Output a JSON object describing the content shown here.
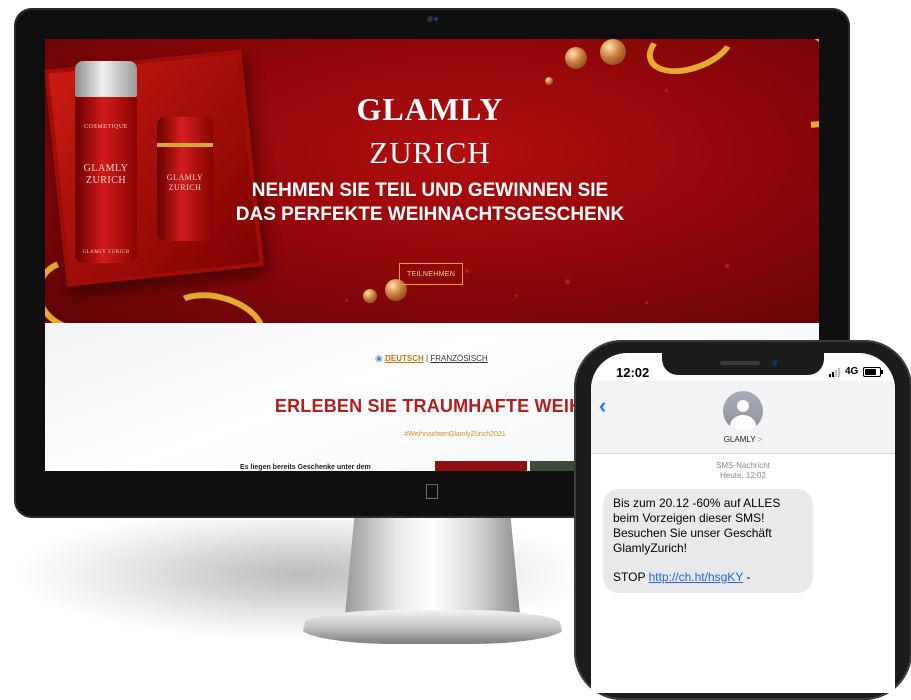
{
  "website": {
    "brand_line1": "GLAMLY",
    "brand_line2": "ZURICH",
    "headline_line1": "NEHMEN SIE TEIL UND GEWINNEN SIE",
    "headline_line2": "DAS PERFEKTE WEIHNACHTSGESCHENK",
    "cta_label": "TEILNEHMEN",
    "bottle_label_top": "COSMETIQUE",
    "bottle_label_big": "GLAMLY ZURICH",
    "bottle_label_small": "GLAMLY ZURICH",
    "bottle_label_bottom": "GLAMLY ZURICH",
    "language": {
      "active": "DEUTSCH",
      "separator": "|",
      "other": "FRANZÖSISCH"
    },
    "subheading": "ERLEBEN SIE TRAUMHAFTE WEIHNACH",
    "hashtag": "#WeihnachtenGlamlyZürich2021",
    "paragraph": "Es liegen bereits Geschenke unter dem"
  },
  "phone": {
    "time": "12:02",
    "network": "4G",
    "contact_name": "GLAMLY",
    "contact_chevron": ">",
    "message_type": "SMS-Nachricht",
    "message_time": "Heute, 12:02",
    "message_lines": [
      "Bis zum 20.12 -60% auf ALLES",
      "beim Vorzeigen dieser SMS!",
      "Besuchen Sie unser Geschäft",
      "GlamlyZurich!"
    ],
    "stop_label": "STOP",
    "link": "http://ch.ht/hsgKY",
    "link_suffix": "-"
  },
  "colors": {
    "hero_red": "#8e0709",
    "gold": "#e3ac2e",
    "subheading_red": "#b0201c",
    "ios_blue": "#1f7cf2",
    "bubble_gray": "#e9e9eb"
  },
  "icons": [
    "apple-icon",
    "globe-icon",
    "back-chevron-icon",
    "contact-avatar-icon",
    "signal-icon",
    "battery-icon"
  ]
}
